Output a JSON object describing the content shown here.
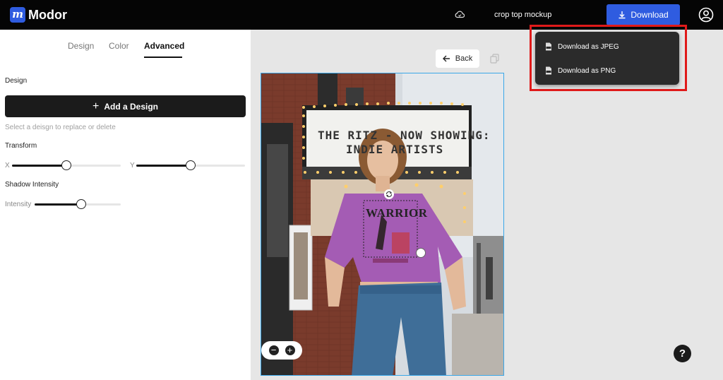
{
  "app": {
    "logo_glyph": "m",
    "name": "Modor"
  },
  "header": {
    "cloud_icon": "cloud-sync-icon",
    "project_title": "crop top mockup",
    "download_label": "Download",
    "account_icon": "user-circle-icon"
  },
  "download_menu": {
    "items": [
      {
        "label": "Download as JPEG",
        "icon": "jpeg-file-icon"
      },
      {
        "label": "Download as PNG",
        "icon": "png-file-icon"
      }
    ]
  },
  "left_panel": {
    "tabs": [
      {
        "label": "Design",
        "active": false
      },
      {
        "label": "Color",
        "active": false
      },
      {
        "label": "Advanced",
        "active": true
      }
    ],
    "design_section_label": "Design",
    "add_design_label": "Add a Design",
    "hint": "Select a deisgn to replace or delete",
    "transform_label": "Transform",
    "x_label": "X",
    "y_label": "Y",
    "x_value_fraction": 0.5,
    "y_value_fraction": 0.5,
    "shadow_label": "Shadow Intensity",
    "intensity_label": "Intensity",
    "intensity_value_fraction": 0.54
  },
  "canvas": {
    "back_label": "Back",
    "marquee_line1": "THE RITZ - NOW SHOWING:",
    "marquee_line2": "INDIE ARTISTS",
    "shirt_text": "WARRIOR",
    "help_label": "?"
  },
  "colors": {
    "accent": "#2f5ce0",
    "highlight": "#e01a1a",
    "shirt": "#a45cb4",
    "selection": "#3aa7e8"
  }
}
